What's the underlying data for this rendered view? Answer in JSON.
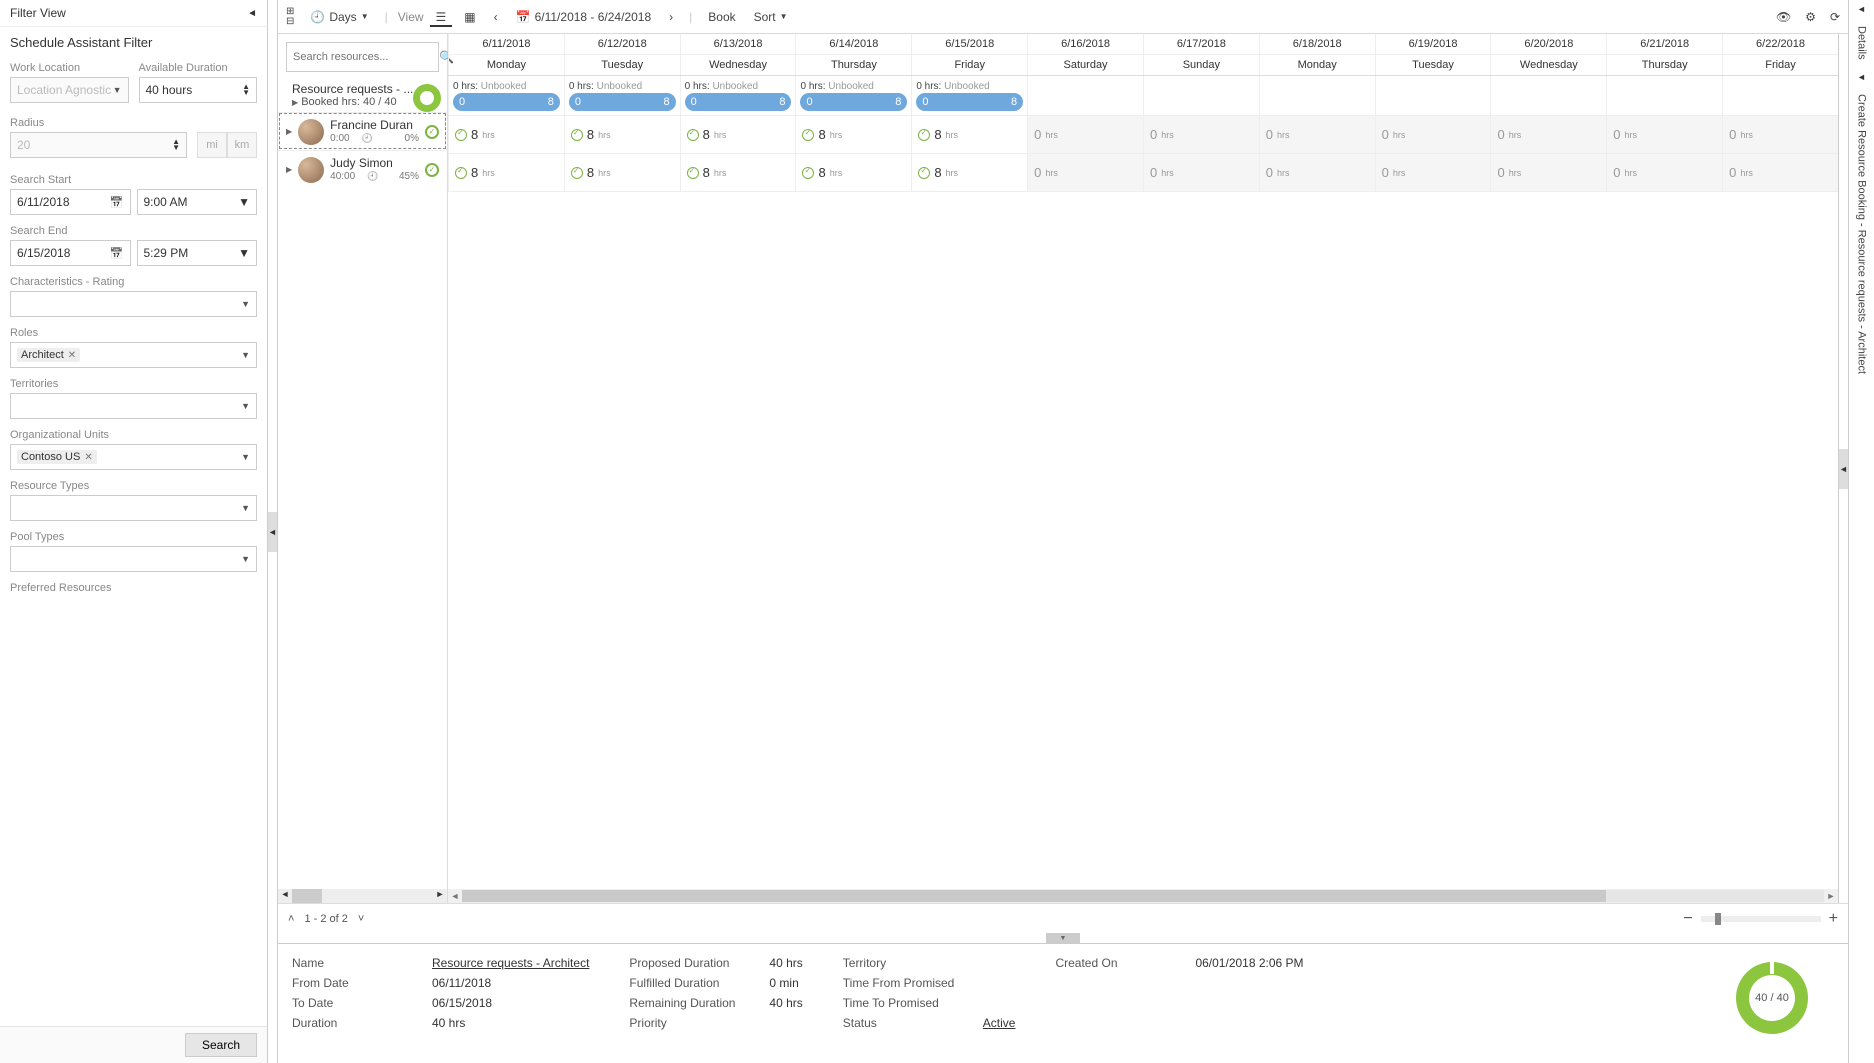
{
  "filter": {
    "title": "Filter View",
    "subtitle": "Schedule Assistant Filter",
    "work_location_label": "Work Location",
    "work_location_value": "Location Agnostic",
    "available_duration_label": "Available Duration",
    "available_duration_value": "40 hours",
    "radius_label": "Radius",
    "radius_value": "20",
    "radius_unit_mi": "mi",
    "radius_unit_km": "km",
    "search_start_label": "Search Start",
    "search_start_date": "6/11/2018",
    "search_start_time": "9:00 AM",
    "search_end_label": "Search End",
    "search_end_date": "6/15/2018",
    "search_end_time": "5:29 PM",
    "characteristics_label": "Characteristics - Rating",
    "roles_label": "Roles",
    "roles_tag": "Architect",
    "territories_label": "Territories",
    "org_units_label": "Organizational Units",
    "org_units_tag": "Contoso US",
    "resource_types_label": "Resource Types",
    "pool_types_label": "Pool Types",
    "preferred_label": "Preferred Resources",
    "search_btn": "Search"
  },
  "toolbar": {
    "days_label": "Days",
    "view_label": "View",
    "date_range": "6/11/2018 - 6/24/2018",
    "book_label": "Book",
    "sort_label": "Sort"
  },
  "search_resources_placeholder": "Search resources...",
  "summary": {
    "title": "Resource requests - ...",
    "booked_label": "Booked hrs: 40 / 40"
  },
  "resources": [
    {
      "name": "Francine Duran",
      "time": "0:00",
      "pct": "0%"
    },
    {
      "name": "Judy Simon",
      "time": "40:00",
      "pct": "45%"
    }
  ],
  "days": [
    {
      "date": "6/11/2018",
      "dow": "Monday",
      "unbooked": "0 hrs:",
      "pill_a": "0",
      "pill_b": "8",
      "avail": true
    },
    {
      "date": "6/12/2018",
      "dow": "Tuesday",
      "unbooked": "0 hrs:",
      "pill_a": "0",
      "pill_b": "8",
      "avail": true
    },
    {
      "date": "6/13/2018",
      "dow": "Wednesday",
      "unbooked": "0 hrs:",
      "pill_a": "0",
      "pill_b": "8",
      "avail": true
    },
    {
      "date": "6/14/2018",
      "dow": "Thursday",
      "unbooked": "0 hrs:",
      "pill_a": "0",
      "pill_b": "8",
      "avail": true
    },
    {
      "date": "6/15/2018",
      "dow": "Friday",
      "unbooked": "0 hrs:",
      "pill_a": "0",
      "pill_b": "8",
      "avail": true
    },
    {
      "date": "6/16/2018",
      "dow": "Saturday",
      "avail": false
    },
    {
      "date": "6/17/2018",
      "dow": "Sunday",
      "avail": false
    },
    {
      "date": "6/18/2018",
      "dow": "Monday",
      "avail": false
    },
    {
      "date": "6/19/2018",
      "dow": "Tuesday",
      "avail": false
    },
    {
      "date": "6/20/2018",
      "dow": "Wednesday",
      "avail": false
    },
    {
      "date": "6/21/2018",
      "dow": "Thursday",
      "avail": false
    },
    {
      "date": "6/22/2018",
      "dow": "Friday",
      "avail": false
    }
  ],
  "cell_hours_avail": "8",
  "cell_hours_unavail": "0",
  "cell_hours_suffix": "hrs",
  "unbooked_word": "Unbooked",
  "pager": {
    "text": "1 - 2 of 2"
  },
  "details": {
    "name_label": "Name",
    "name_value": "Resource requests - Architect",
    "from_label": "From Date",
    "from_value": "06/11/2018",
    "to_label": "To Date",
    "to_value": "06/15/2018",
    "duration_label": "Duration",
    "duration_value": "40 hrs",
    "proposed_label": "Proposed Duration",
    "proposed_value": "40 hrs",
    "fulfilled_label": "Fulfilled Duration",
    "fulfilled_value": "0 min",
    "remaining_label": "Remaining Duration",
    "remaining_value": "40 hrs",
    "priority_label": "Priority",
    "territory_label": "Territory",
    "tfp_label": "Time From Promised",
    "ttp_label": "Time To Promised",
    "status_label": "Status",
    "status_value": "Active",
    "created_label": "Created On",
    "created_value": "06/01/2018 2:06 PM",
    "donut_center": "40 / 40"
  },
  "right_rail": {
    "top": "Details",
    "bottom": "Create Resource Booking - Resource requests - Architect"
  }
}
